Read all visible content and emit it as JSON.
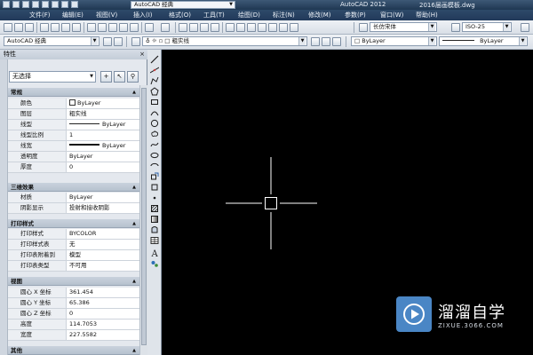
{
  "titlebar": {
    "workspace": "AutoCAD 经典",
    "app_title": "AutoCAD 2012",
    "file_title": "2016届画模板.dwg"
  },
  "menubar": {
    "items": [
      "文件(F)",
      "编辑(E)",
      "视图(V)",
      "插入(I)",
      "格式(O)",
      "工具(T)",
      "绘图(D)",
      "标注(N)",
      "修改(M)",
      "参数(P)",
      "窗口(W)",
      "帮助(H)"
    ]
  },
  "toolbar1": {
    "text_style": "长仿宋体",
    "dim_style": "ISO-25"
  },
  "toolbar2": {
    "workspace": "AutoCAD 经典",
    "layer": "粗实线",
    "color": "ByLayer",
    "linetype": "ByLayer"
  },
  "palette": {
    "title": "特性",
    "close": "×",
    "selection": "无选择",
    "sections": {
      "general": {
        "title": "常规",
        "rows": [
          {
            "name": "颜色",
            "value": "ByLayer"
          },
          {
            "name": "图层",
            "value": "粗实线"
          },
          {
            "name": "线型",
            "value": "ByLayer"
          },
          {
            "name": "线型比例",
            "value": "1"
          },
          {
            "name": "线宽",
            "value": "ByLayer"
          },
          {
            "name": "透明度",
            "value": "ByLayer"
          },
          {
            "name": "厚度",
            "value": "0"
          }
        ]
      },
      "threed": {
        "title": "三维效果",
        "rows": [
          {
            "name": "材质",
            "value": "ByLayer"
          },
          {
            "name": "阴影显示",
            "value": "投射和接收阴影"
          }
        ]
      },
      "plot": {
        "title": "打印样式",
        "rows": [
          {
            "name": "打印样式",
            "value": "BYCOLOR"
          },
          {
            "name": "打印样式表",
            "value": "无"
          },
          {
            "name": "打印表附着到",
            "value": "模型"
          },
          {
            "name": "打印表类型",
            "value": "不可用"
          }
        ]
      },
      "view": {
        "title": "视图",
        "rows": [
          {
            "name": "圆心 X 坐标",
            "value": "361.454"
          },
          {
            "name": "圆心 Y 坐标",
            "value": "65.386"
          },
          {
            "name": "圆心 Z 坐标",
            "value": "0"
          },
          {
            "name": "高度",
            "value": "114.7053"
          },
          {
            "name": "宽度",
            "value": "227.5582"
          }
        ]
      },
      "misc": {
        "title": "其他"
      }
    }
  },
  "watermark": {
    "name_cn": "溜溜自学",
    "site": "ZIXUE.3066.COM"
  },
  "colors": {
    "canvas": "#000000",
    "titlebar": "#2e4a69",
    "watermark_accent": "#4a86c5"
  }
}
